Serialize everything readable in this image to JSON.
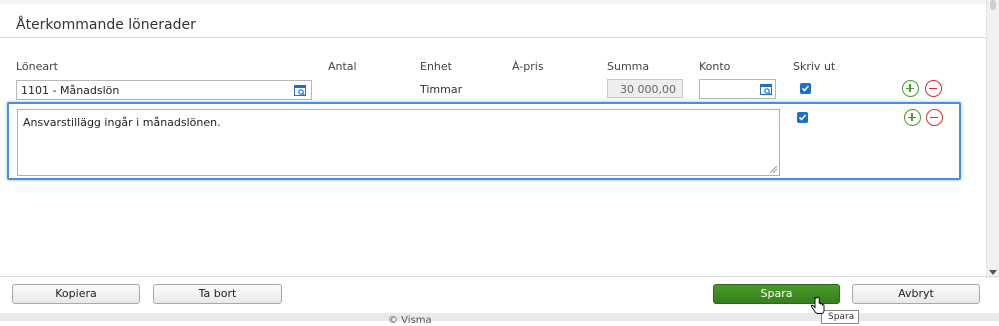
{
  "section": {
    "title": "Återkommande lönerader"
  },
  "columns": {
    "loneart": "Löneart",
    "antal": "Antal",
    "enhet": "Enhet",
    "apris": "À-pris",
    "summa": "Summa",
    "konto": "Konto",
    "skriv_ut": "Skriv ut"
  },
  "row": {
    "loneart_value": "1101 - Månadslön",
    "unit": "Timmar",
    "sum": "30 000,00",
    "konto_value": "",
    "print_checked": true
  },
  "note": {
    "text": "Ansvarstillägg ingår i månadslönen.",
    "print_checked": true
  },
  "buttons": {
    "copy": "Kopiera",
    "delete": "Ta bort",
    "save": "Spara",
    "cancel": "Avbryt"
  },
  "tooltip": "Spara",
  "footer": {
    "copyright": "© Visma"
  },
  "colors": {
    "accent_blue": "#4a90d9",
    "save_green": "#3f8d22",
    "add_green": "#4a9a2e",
    "remove_red": "#cc3333",
    "checkbox_blue": "#1f6fc8"
  },
  "icons": {
    "lookup": "lookup-icon",
    "add": "plus-circle-icon",
    "remove": "minus-circle-icon",
    "checkbox": "checkmark-icon"
  }
}
